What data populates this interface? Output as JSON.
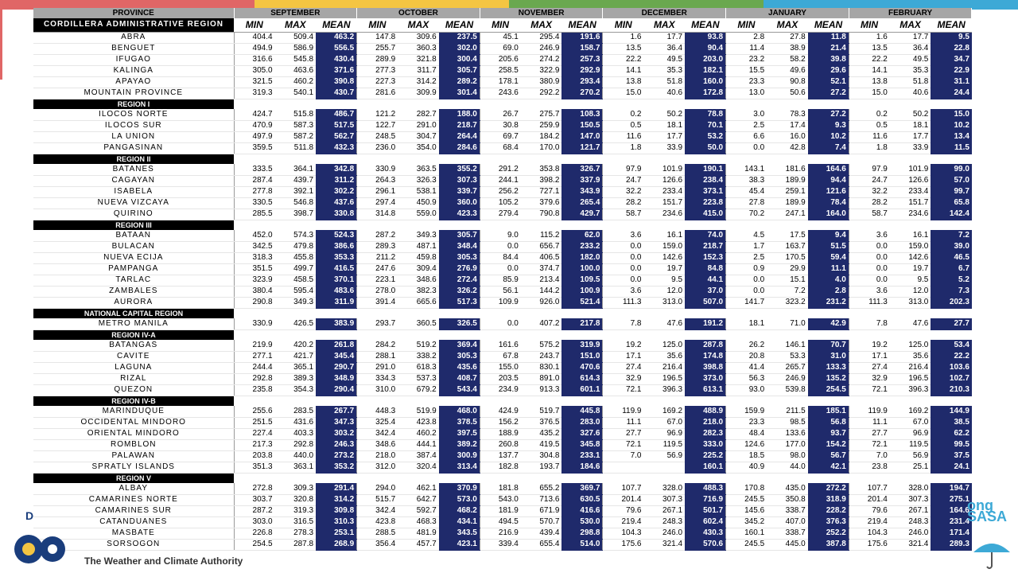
{
  "stripe_colors": [
    "#e06666",
    "#f4c542",
    "#6aa84f",
    "#3da9d6"
  ],
  "headers": {
    "province": "PROVINCE",
    "months": [
      "SEPTEMBER",
      "OCTOBER",
      "NOVEMBER",
      "DECEMBER",
      "JANUARY",
      "FEBRUARY"
    ],
    "sub": [
      "MIN",
      "MAX",
      "MEAN"
    ]
  },
  "regions": [
    {
      "name": "CORDILLERA ADMINISTRATIVE REGION",
      "rows": [
        {
          "p": "ABRA",
          "v": [
            "404.4",
            "509.4",
            "463.2",
            "147.8",
            "309.6",
            "237.5",
            "45.1",
            "295.4",
            "191.6",
            "1.6",
            "17.7",
            "93.8",
            "2.8",
            "27.8",
            "11.8",
            "1.6",
            "17.7",
            "9.5"
          ]
        },
        {
          "p": "BENGUET",
          "v": [
            "494.9",
            "586.9",
            "556.5",
            "255.7",
            "360.3",
            "302.0",
            "69.0",
            "246.9",
            "158.7",
            "13.5",
            "36.4",
            "90.4",
            "11.4",
            "38.9",
            "21.4",
            "13.5",
            "36.4",
            "22.8"
          ]
        },
        {
          "p": "IFUGAO",
          "v": [
            "316.6",
            "545.8",
            "430.4",
            "289.9",
            "321.8",
            "300.4",
            "205.6",
            "274.2",
            "257.3",
            "22.2",
            "49.5",
            "203.0",
            "23.2",
            "58.2",
            "39.8",
            "22.2",
            "49.5",
            "34.7"
          ]
        },
        {
          "p": "KALINGA",
          "v": [
            "305.0",
            "463.6",
            "371.6",
            "277.3",
            "311.7",
            "305.7",
            "258.5",
            "322.9",
            "292.9",
            "14.1",
            "35.3",
            "182.1",
            "15.5",
            "49.6",
            "29.6",
            "14.1",
            "35.3",
            "22.9"
          ]
        },
        {
          "p": "APAYAO",
          "v": [
            "321.5",
            "460.2",
            "390.8",
            "227.3",
            "314.2",
            "289.2",
            "178.1",
            "380.9",
            "293.4",
            "13.8",
            "51.8",
            "160.0",
            "23.3",
            "90.8",
            "52.1",
            "13.8",
            "51.8",
            "31.1"
          ]
        },
        {
          "p": "MOUNTAIN PROVINCE",
          "v": [
            "319.3",
            "540.1",
            "430.7",
            "281.6",
            "309.9",
            "301.4",
            "243.6",
            "292.2",
            "270.2",
            "15.0",
            "40.6",
            "172.8",
            "13.0",
            "50.6",
            "27.2",
            "15.0",
            "40.6",
            "24.4"
          ]
        }
      ]
    },
    {
      "name": "REGION I",
      "rows": [
        {
          "p": "ILOCOS NORTE",
          "v": [
            "424.7",
            "515.8",
            "486.7",
            "121.2",
            "282.7",
            "188.0",
            "26.7",
            "275.7",
            "108.3",
            "0.2",
            "50.2",
            "78.8",
            "3.0",
            "78.3",
            "27.2",
            "0.2",
            "50.2",
            "15.0"
          ]
        },
        {
          "p": "ILOCOS SUR",
          "v": [
            "470.9",
            "587.3",
            "517.5",
            "122.7",
            "291.0",
            "218.7",
            "30.8",
            "259.9",
            "150.5",
            "0.5",
            "18.1",
            "70.1",
            "2.5",
            "17.4",
            "9.3",
            "0.5",
            "18.1",
            "10.2"
          ]
        },
        {
          "p": "LA UNION",
          "v": [
            "497.9",
            "587.2",
            "562.7",
            "248.5",
            "304.7",
            "264.4",
            "69.7",
            "184.2",
            "147.0",
            "11.6",
            "17.7",
            "53.2",
            "6.6",
            "16.0",
            "10.2",
            "11.6",
            "17.7",
            "13.4"
          ]
        },
        {
          "p": "PANGASINAN",
          "v": [
            "359.5",
            "511.8",
            "432.3",
            "236.0",
            "354.0",
            "284.6",
            "68.4",
            "170.0",
            "121.7",
            "1.8",
            "33.9",
            "50.0",
            "0.0",
            "42.8",
            "7.4",
            "1.8",
            "33.9",
            "11.5"
          ]
        }
      ]
    },
    {
      "name": "REGION II",
      "rows": [
        {
          "p": "BATANES",
          "v": [
            "333.5",
            "364.1",
            "342.8",
            "330.9",
            "363.5",
            "355.2",
            "291.2",
            "353.8",
            "326.7",
            "97.9",
            "101.9",
            "190.1",
            "143.1",
            "181.6",
            "164.6",
            "97.9",
            "101.9",
            "99.0"
          ]
        },
        {
          "p": "CAGAYAN",
          "v": [
            "287.4",
            "439.7",
            "311.2",
            "264.3",
            "326.3",
            "307.3",
            "244.1",
            "398.2",
            "337.9",
            "24.7",
            "126.6",
            "238.4",
            "38.3",
            "189.9",
            "94.4",
            "24.7",
            "126.6",
            "57.0"
          ]
        },
        {
          "p": "ISABELA",
          "v": [
            "277.8",
            "392.1",
            "302.2",
            "296.1",
            "538.1",
            "339.7",
            "256.2",
            "727.1",
            "343.9",
            "32.2",
            "233.4",
            "373.1",
            "45.4",
            "259.1",
            "121.6",
            "32.2",
            "233.4",
            "99.7"
          ]
        },
        {
          "p": "NUEVA VIZCAYA",
          "v": [
            "330.5",
            "546.8",
            "437.6",
            "297.4",
            "450.9",
            "360.0",
            "105.2",
            "379.6",
            "265.4",
            "28.2",
            "151.7",
            "223.8",
            "27.8",
            "189.9",
            "78.4",
            "28.2",
            "151.7",
            "65.8"
          ]
        },
        {
          "p": "QUIRINO",
          "v": [
            "285.5",
            "398.7",
            "330.8",
            "314.8",
            "559.0",
            "423.3",
            "279.4",
            "790.8",
            "429.7",
            "58.7",
            "234.6",
            "415.0",
            "70.2",
            "247.1",
            "164.0",
            "58.7",
            "234.6",
            "142.4"
          ]
        }
      ]
    },
    {
      "name": "REGION III",
      "rows": [
        {
          "p": "BATAAN",
          "v": [
            "452.0",
            "574.3",
            "524.3",
            "287.2",
            "349.3",
            "305.7",
            "9.0",
            "115.2",
            "62.0",
            "3.6",
            "16.1",
            "74.0",
            "4.5",
            "17.5",
            "9.4",
            "3.6",
            "16.1",
            "7.2"
          ]
        },
        {
          "p": "BULACAN",
          "v": [
            "342.5",
            "479.8",
            "386.6",
            "289.3",
            "487.1",
            "348.4",
            "0.0",
            "656.7",
            "233.2",
            "0.0",
            "159.0",
            "218.7",
            "1.7",
            "163.7",
            "51.5",
            "0.0",
            "159.0",
            "39.0"
          ]
        },
        {
          "p": "NUEVA ECIJA",
          "v": [
            "318.3",
            "455.8",
            "353.3",
            "211.2",
            "459.8",
            "305.3",
            "84.4",
            "406.5",
            "182.0",
            "0.0",
            "142.6",
            "152.3",
            "2.5",
            "170.5",
            "59.4",
            "0.0",
            "142.6",
            "46.5"
          ]
        },
        {
          "p": "PAMPANGA",
          "v": [
            "351.5",
            "499.7",
            "416.5",
            "247.6",
            "309.4",
            "276.9",
            "0.0",
            "374.7",
            "100.0",
            "0.0",
            "19.7",
            "84.8",
            "0.9",
            "29.9",
            "11.1",
            "0.0",
            "19.7",
            "6.7"
          ]
        },
        {
          "p": "TARLAC",
          "v": [
            "323.9",
            "458.5",
            "370.1",
            "223.1",
            "348.6",
            "272.4",
            "85.9",
            "213.4",
            "109.5",
            "0.0",
            "9.5",
            "44.1",
            "0.0",
            "15.1",
            "4.0",
            "0.0",
            "9.5",
            "5.2"
          ]
        },
        {
          "p": "ZAMBALES",
          "v": [
            "380.4",
            "595.4",
            "483.6",
            "278.0",
            "382.3",
            "326.2",
            "56.1",
            "144.2",
            "100.9",
            "3.6",
            "12.0",
            "37.0",
            "0.0",
            "7.2",
            "2.8",
            "3.6",
            "12.0",
            "7.3"
          ]
        },
        {
          "p": "AURORA",
          "v": [
            "290.8",
            "349.3",
            "311.9",
            "391.4",
            "665.6",
            "517.3",
            "109.9",
            "926.0",
            "521.4",
            "111.3",
            "313.0",
            "507.0",
            "141.7",
            "323.2",
            "231.2",
            "111.3",
            "313.0",
            "202.3"
          ]
        }
      ]
    },
    {
      "name": "NATIONAL CAPITAL REGION",
      "rows": [
        {
          "p": "METRO MANILA",
          "v": [
            "330.9",
            "426.5",
            "383.9",
            "293.7",
            "360.5",
            "326.5",
            "0.0",
            "407.2",
            "217.8",
            "7.8",
            "47.6",
            "191.2",
            "18.1",
            "71.0",
            "42.9",
            "7.8",
            "47.6",
            "27.7"
          ]
        }
      ]
    },
    {
      "name": "REGION IV-A",
      "rows": [
        {
          "p": "BATANGAS",
          "v": [
            "219.9",
            "420.2",
            "261.8",
            "284.2",
            "519.2",
            "369.4",
            "161.6",
            "575.2",
            "319.9",
            "19.2",
            "125.0",
            "287.8",
            "26.2",
            "146.1",
            "70.7",
            "19.2",
            "125.0",
            "53.4"
          ]
        },
        {
          "p": "CAVITE",
          "v": [
            "277.1",
            "421.7",
            "345.4",
            "288.1",
            "338.2",
            "305.3",
            "67.8",
            "243.7",
            "151.0",
            "17.1",
            "35.6",
            "174.8",
            "20.8",
            "53.3",
            "31.0",
            "17.1",
            "35.6",
            "22.2"
          ]
        },
        {
          "p": "LAGUNA",
          "v": [
            "244.4",
            "365.1",
            "290.7",
            "291.0",
            "618.3",
            "435.6",
            "155.0",
            "830.1",
            "470.6",
            "27.4",
            "216.4",
            "398.8",
            "41.4",
            "265.7",
            "133.3",
            "27.4",
            "216.4",
            "103.6"
          ]
        },
        {
          "p": "RIZAL",
          "v": [
            "292.8",
            "389.3",
            "348.9",
            "334.3",
            "537.3",
            "408.7",
            "203.5",
            "891.0",
            "614.3",
            "32.9",
            "196.5",
            "373.0",
            "56.3",
            "246.9",
            "135.2",
            "32.9",
            "196.5",
            "102.7"
          ]
        },
        {
          "p": "QUEZON",
          "v": [
            "235.8",
            "354.3",
            "290.4",
            "310.0",
            "679.2",
            "543.4",
            "234.9",
            "913.3",
            "601.1",
            "72.1",
            "396.3",
            "613.1",
            "93.0",
            "539.8",
            "254.5",
            "72.1",
            "396.3",
            "210.3"
          ]
        }
      ]
    },
    {
      "name": "REGION IV-B",
      "rows": [
        {
          "p": "MARINDUQUE",
          "v": [
            "255.6",
            "283.5",
            "267.7",
            "448.3",
            "519.9",
            "468.0",
            "424.9",
            "519.7",
            "445.8",
            "119.9",
            "169.2",
            "488.9",
            "159.9",
            "211.5",
            "185.1",
            "119.9",
            "169.2",
            "144.9"
          ]
        },
        {
          "p": "OCCIDENTAL MINDORO",
          "v": [
            "251.5",
            "431.6",
            "347.3",
            "325.4",
            "423.8",
            "378.5",
            "156.2",
            "376.5",
            "283.0",
            "11.1",
            "67.0",
            "218.0",
            "23.3",
            "98.5",
            "56.8",
            "11.1",
            "67.0",
            "38.5"
          ]
        },
        {
          "p": "ORIENTAL MINDORO",
          "v": [
            "227.4",
            "403.3",
            "303.2",
            "342.4",
            "460.2",
            "397.5",
            "188.9",
            "435.2",
            "327.6",
            "27.7",
            "96.9",
            "282.3",
            "48.4",
            "133.6",
            "93.7",
            "27.7",
            "96.9",
            "62.2"
          ]
        },
        {
          "p": "ROMBLON",
          "v": [
            "217.3",
            "292.8",
            "246.3",
            "348.6",
            "444.1",
            "389.2",
            "260.8",
            "419.5",
            "345.8",
            "72.1",
            "119.5",
            "333.0",
            "124.6",
            "177.0",
            "154.2",
            "72.1",
            "119.5",
            "99.5"
          ]
        },
        {
          "p": "PALAWAN",
          "v": [
            "203.8",
            "440.0",
            "273.2",
            "218.0",
            "387.4",
            "300.9",
            "137.7",
            "304.8",
            "233.1",
            "7.0",
            "56.9",
            "225.2",
            "18.5",
            "98.0",
            "56.7",
            "7.0",
            "56.9",
            "37.5"
          ]
        },
        {
          "p": "SPRATLY ISLANDS",
          "v": [
            "351.3",
            "363.1",
            "353.2",
            "312.0",
            "320.4",
            "313.4",
            "182.8",
            "193.7",
            "184.6",
            "",
            "",
            "160.1",
            "40.9",
            "44.0",
            "42.1",
            "23.8",
            "25.1",
            "24.1"
          ]
        }
      ]
    },
    {
      "name": "REGION V",
      "rows": [
        {
          "p": "ALBAY",
          "v": [
            "272.8",
            "309.3",
            "291.4",
            "294.0",
            "462.1",
            "370.9",
            "181.8",
            "655.2",
            "369.7",
            "107.7",
            "328.0",
            "488.3",
            "170.8",
            "435.0",
            "272.2",
            "107.7",
            "328.0",
            "194.7"
          ]
        },
        {
          "p": "CAMARINES NORTE",
          "v": [
            "303.7",
            "320.8",
            "314.2",
            "515.7",
            "642.7",
            "573.0",
            "543.0",
            "713.6",
            "630.5",
            "201.4",
            "307.3",
            "716.9",
            "245.5",
            "350.8",
            "318.9",
            "201.4",
            "307.3",
            "275.1"
          ]
        },
        {
          "p": "CAMARINES SUR",
          "v": [
            "287.2",
            "319.3",
            "309.8",
            "342.4",
            "592.7",
            "468.2",
            "181.9",
            "671.9",
            "416.6",
            "79.6",
            "267.1",
            "501.7",
            "145.6",
            "338.7",
            "228.2",
            "79.6",
            "267.1",
            "164.6"
          ]
        },
        {
          "p": "CATANDUANES",
          "v": [
            "303.0",
            "316.5",
            "310.3",
            "423.8",
            "468.3",
            "434.1",
            "494.5",
            "570.7",
            "530.0",
            "219.4",
            "248.3",
            "602.4",
            "345.2",
            "407.0",
            "376.3",
            "219.4",
            "248.3",
            "231.4"
          ]
        },
        {
          "p": "MASBATE",
          "v": [
            "226.8",
            "278.3",
            "253.1",
            "288.5",
            "481.9",
            "343.5",
            "216.9",
            "439.4",
            "298.8",
            "104.3",
            "246.0",
            "430.3",
            "160.1",
            "338.7",
            "252.2",
            "104.3",
            "246.0",
            "171.4"
          ]
        },
        {
          "p": "SORSOGON",
          "v": [
            "254.5",
            "287.8",
            "268.9",
            "356.4",
            "457.7",
            "423.1",
            "339.4",
            "655.4",
            "514.0",
            "175.6",
            "321.4",
            "570.6",
            "245.5",
            "445.0",
            "387.8",
            "175.6",
            "321.4",
            "289.3"
          ]
        }
      ]
    }
  ],
  "footer": {
    "authority_text": "The Weather and Climate Authority",
    "left_mark": "D",
    "right_logo_line1": "ong",
    "right_logo_line2": "SASA"
  }
}
